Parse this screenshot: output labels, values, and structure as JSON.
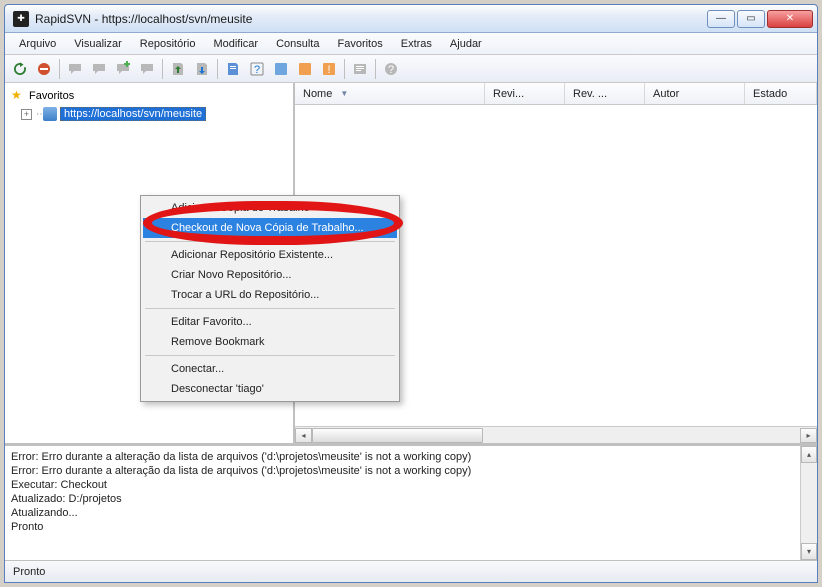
{
  "title": "RapidSVN - https://localhost/svn/meusite",
  "menubar": [
    "Arquivo",
    "Visualizar",
    "Repositório",
    "Modificar",
    "Consulta",
    "Favoritos",
    "Extras",
    "Ajudar"
  ],
  "toolbar_icons": [
    "refresh",
    "stop",
    "speech1",
    "speech2",
    "speech-add",
    "speech-info",
    "commit",
    "update",
    "doc-add",
    "doc-del",
    "blame",
    "info-panel",
    "info-panel2",
    "warn-panel",
    "warn-panel2",
    "props",
    "about"
  ],
  "tree": {
    "header": "Favoritos",
    "node_url": "https://localhost/svn/meusite"
  },
  "columns": {
    "name": "Nome",
    "rev1": "Revi...",
    "rev2": "Rev. ...",
    "author": "Autor",
    "state": "Estado"
  },
  "context_menu": {
    "items": [
      "Adicionar Cópia de Trabalho",
      "Checkout de Nova Cópia de Trabalho...",
      "Adicionar Repositório Existente...",
      "Criar Novo Repositório...",
      "Trocar a URL do Repositório...",
      "Editar Favorito...",
      "Remove Bookmark",
      "Conectar...",
      "Desconectar 'tiago'"
    ],
    "highlighted_index": 1
  },
  "log": [
    "Error: Erro durante a alteração da lista de arquivos ('d:\\projetos\\meusite' is not a working copy)",
    "Error: Erro durante a alteração da lista de arquivos ('d:\\projetos\\meusite' is not a working copy)",
    "Executar: Checkout",
    "Atualizado: D:/projetos",
    "Atualizando...",
    "Pronto"
  ],
  "status": "Pronto",
  "colors": {
    "highlight": "#2c82e0",
    "ring": "#e11515"
  }
}
